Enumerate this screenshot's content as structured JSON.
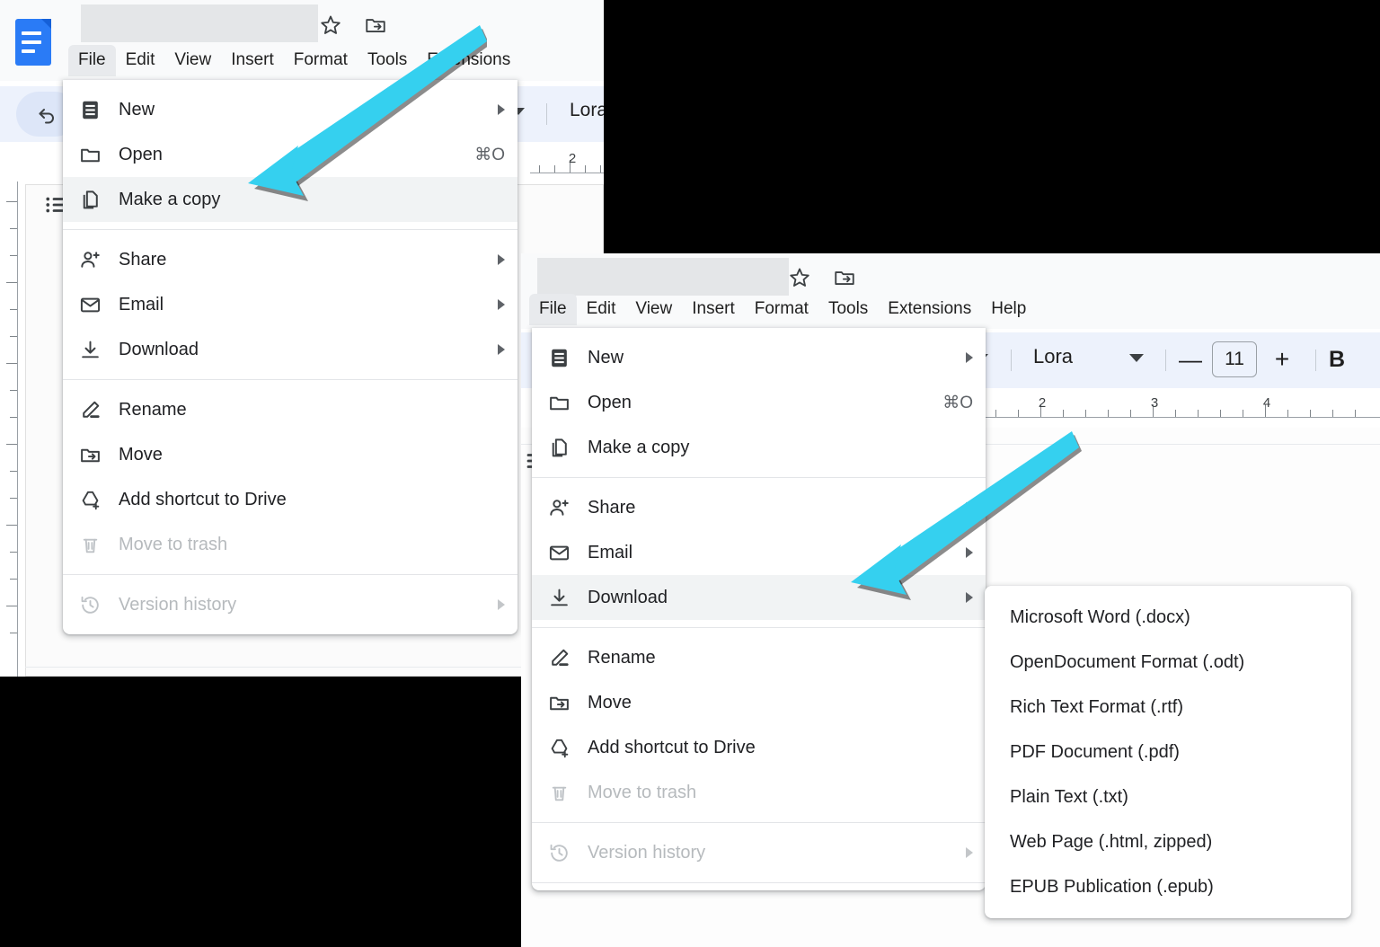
{
  "app": {
    "name": "Google Docs",
    "accent_color": "#2a7bf6",
    "annotation_arrow_color": "#35d0ef",
    "highlight_color": "#f1f3f4"
  },
  "window_one": {
    "doc_icon_name": "google-docs-icon",
    "title_redacted": true,
    "title": "",
    "star_icon": "star-icon",
    "move_folder_icon": "move-to-folder-icon",
    "menubar": [
      {
        "label": "File",
        "active": true
      },
      {
        "label": "Edit",
        "active": false
      },
      {
        "label": "View",
        "active": false
      },
      {
        "label": "Insert",
        "active": false
      },
      {
        "label": "Format",
        "active": false
      },
      {
        "label": "Tools",
        "active": false
      },
      {
        "label": "Extensions",
        "active": false
      }
    ],
    "toolbar": {
      "undo_icon": "undo-icon",
      "font_name": "Lora"
    },
    "ruler": {
      "labels": [
        "2"
      ]
    },
    "file_menu": [
      {
        "label": "New",
        "icon": "new-document-icon",
        "accel": "",
        "arrow": true,
        "disabled": false,
        "highlight": false
      },
      {
        "label": "Open",
        "icon": "folder-icon",
        "accel": "⌘O",
        "arrow": false,
        "disabled": false,
        "highlight": false
      },
      {
        "label": "Make a copy",
        "icon": "copy-icon",
        "accel": "",
        "arrow": false,
        "disabled": false,
        "highlight": true
      },
      {
        "separator": true
      },
      {
        "label": "Share",
        "icon": "person-add-icon",
        "accel": "",
        "arrow": true,
        "disabled": false,
        "highlight": false
      },
      {
        "label": "Email",
        "icon": "envelope-icon",
        "accel": "",
        "arrow": true,
        "disabled": false,
        "highlight": false
      },
      {
        "label": "Download",
        "icon": "download-icon",
        "accel": "",
        "arrow": true,
        "disabled": false,
        "highlight": false
      },
      {
        "separator": true
      },
      {
        "label": "Rename",
        "icon": "pencil-icon",
        "accel": "",
        "arrow": false,
        "disabled": false,
        "highlight": false
      },
      {
        "label": "Move",
        "icon": "move-folder-icon",
        "accel": "",
        "arrow": false,
        "disabled": false,
        "highlight": false
      },
      {
        "label": "Add shortcut to Drive",
        "icon": "drive-shortcut-icon",
        "accel": "",
        "arrow": false,
        "disabled": false,
        "highlight": false
      },
      {
        "label": "Move to trash",
        "icon": "trash-icon",
        "accel": "",
        "arrow": false,
        "disabled": true,
        "highlight": false
      },
      {
        "separator": true
      },
      {
        "label": "Version history",
        "icon": "history-icon",
        "accel": "",
        "arrow": true,
        "disabled": true,
        "highlight": false
      }
    ]
  },
  "window_two": {
    "title_redacted": true,
    "title": "",
    "star_icon": "star-icon",
    "move_folder_icon": "move-to-folder-icon",
    "menubar": [
      {
        "label": "File",
        "active": true
      },
      {
        "label": "Edit",
        "active": false
      },
      {
        "label": "View",
        "active": false
      },
      {
        "label": "Insert",
        "active": false
      },
      {
        "label": "Format",
        "active": false
      },
      {
        "label": "Tools",
        "active": false
      },
      {
        "label": "Extensions",
        "active": false
      },
      {
        "label": "Help",
        "active": false
      }
    ],
    "toolbar": {
      "font_name": "Lora",
      "font_size": "11",
      "decrease_label": "—",
      "increase_label": "+",
      "bold_label": "B"
    },
    "ruler": {
      "labels": [
        "2",
        "3",
        "4"
      ]
    },
    "file_menu": [
      {
        "label": "New",
        "icon": "new-document-icon",
        "accel": "",
        "arrow": true,
        "disabled": false,
        "highlight": false
      },
      {
        "label": "Open",
        "icon": "folder-icon",
        "accel": "⌘O",
        "arrow": false,
        "disabled": false,
        "highlight": false
      },
      {
        "label": "Make a copy",
        "icon": "copy-icon",
        "accel": "",
        "arrow": false,
        "disabled": false,
        "highlight": false
      },
      {
        "separator": true
      },
      {
        "label": "Share",
        "icon": "person-add-icon",
        "accel": "",
        "arrow": true,
        "disabled": false,
        "highlight": false
      },
      {
        "label": "Email",
        "icon": "envelope-icon",
        "accel": "",
        "arrow": true,
        "disabled": false,
        "highlight": false
      },
      {
        "label": "Download",
        "icon": "download-icon",
        "accel": "",
        "arrow": true,
        "disabled": false,
        "highlight": true
      },
      {
        "separator": true
      },
      {
        "label": "Rename",
        "icon": "pencil-icon",
        "accel": "",
        "arrow": false,
        "disabled": false,
        "highlight": false
      },
      {
        "label": "Move",
        "icon": "move-folder-icon",
        "accel": "",
        "arrow": false,
        "disabled": false,
        "highlight": false
      },
      {
        "label": "Add shortcut to Drive",
        "icon": "drive-shortcut-icon",
        "accel": "",
        "arrow": false,
        "disabled": false,
        "highlight": false
      },
      {
        "label": "Move to trash",
        "icon": "trash-icon",
        "accel": "",
        "arrow": false,
        "disabled": true,
        "highlight": false
      },
      {
        "separator": true
      },
      {
        "label": "Version history",
        "icon": "history-icon",
        "accel": "",
        "arrow": true,
        "disabled": true,
        "highlight": false
      }
    ],
    "download_submenu": [
      {
        "label": "Microsoft Word (.docx)"
      },
      {
        "label": "OpenDocument Format (.odt)"
      },
      {
        "label": "Rich Text Format (.rtf)"
      },
      {
        "label": "PDF Document (.pdf)"
      },
      {
        "label": "Plain Text (.txt)"
      },
      {
        "label": "Web Page (.html, zipped)"
      },
      {
        "label": "EPUB Publication (.epub)"
      }
    ]
  }
}
